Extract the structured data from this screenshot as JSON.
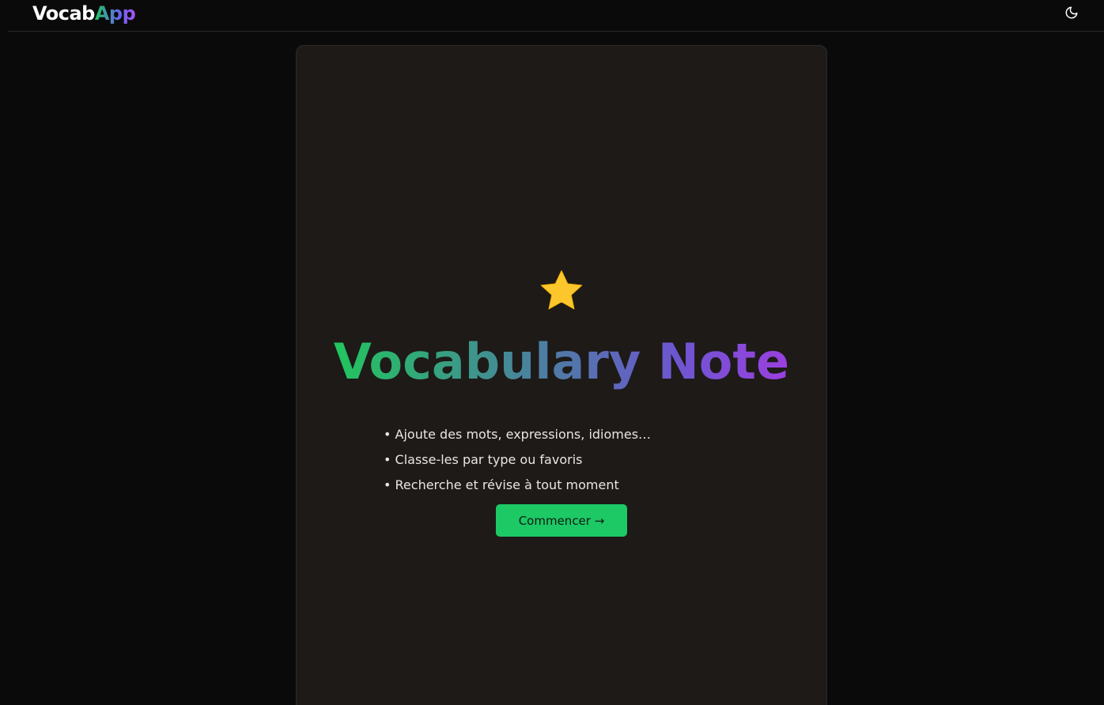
{
  "header": {
    "logo_part_1": "Vocab",
    "logo_part_2": "App",
    "theme_toggle_icon": "moon-icon"
  },
  "hero": {
    "icon": "star-icon",
    "title": "Vocabulary Note",
    "features": [
      "• Ajoute des mots, expressions, idiomes…",
      "• Classe-les par type ou favoris",
      "• Recherche et révise à tout moment"
    ],
    "cta_label": "Commencer →"
  },
  "colors": {
    "background": "#0b0a0a",
    "card": "#1d1a18",
    "accent_green": "#1cc965",
    "gradient_start": "#22c55e",
    "gradient_end": "#9b3fe0",
    "star": "#fcc62d"
  }
}
